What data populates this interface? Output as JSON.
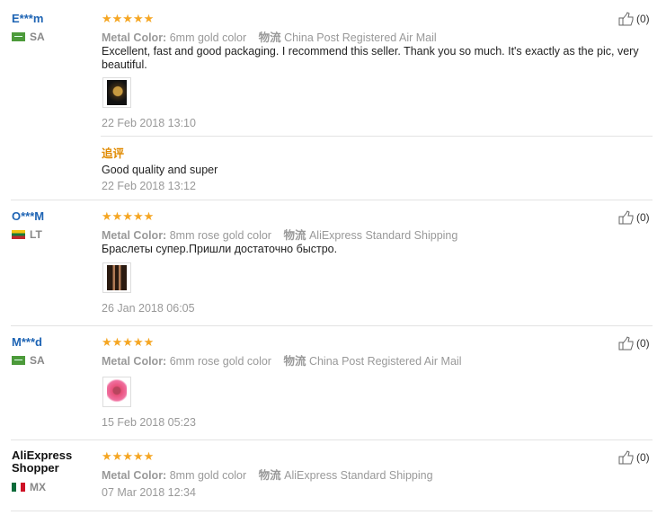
{
  "attr_labels": {
    "metal": "Metal Color:",
    "logistics": "物流"
  },
  "rating_stars": "★★★★★",
  "reviews": [
    {
      "name": "E***m",
      "country": "SA",
      "rating": 5,
      "metal_color": "6mm gold color",
      "shipping": "China Post Registered Air Mail",
      "text": "Excellent, fast and good packaging. I recommend this seller. Thank you so much. It's exactly as the pic, very beautiful.",
      "date": "22 Feb 2018 13:10",
      "additional_label": "追评",
      "additional_text": "Good quality and super",
      "additional_date": "22 Feb 2018 13:12",
      "helpful": "(0)"
    },
    {
      "name": "O***M",
      "country": "LT",
      "rating": 5,
      "metal_color": "8mm rose gold color",
      "shipping": "AliExpress Standard Shipping",
      "text": "Браслеты супер.Пришли достаточно быстро.",
      "date": "26 Jan 2018 06:05",
      "helpful": "(0)"
    },
    {
      "name": "M***d",
      "country": "SA",
      "rating": 5,
      "metal_color": "6mm rose gold color",
      "shipping": "China Post Registered Air Mail",
      "date": "15 Feb 2018 05:23",
      "helpful": "(0)"
    },
    {
      "name": "AliExpress Shopper",
      "country": "MX",
      "rating": 5,
      "metal_color": "8mm gold color",
      "shipping": "AliExpress Standard Shipping",
      "date": "07 Mar 2018 12:34",
      "helpful": "(0)"
    }
  ],
  "colors": {
    "star": "#f5a623",
    "name_link": "#1e64b4",
    "additional": "#e08a00"
  }
}
